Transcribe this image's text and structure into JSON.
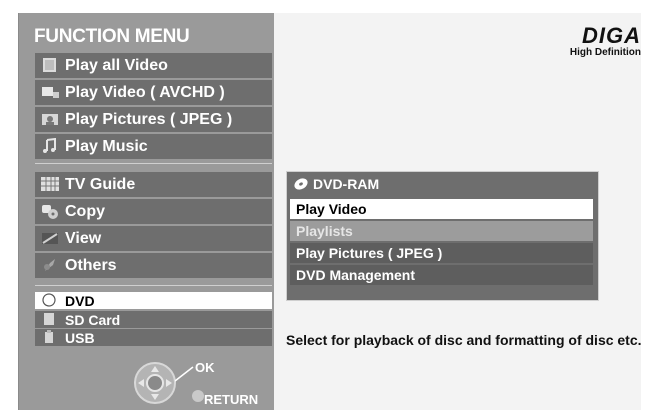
{
  "logo": {
    "brand": "DIGA",
    "subtitle": "High Definition"
  },
  "menu": {
    "title": "FUNCTION MENU",
    "items": [
      {
        "label": "Play all Video",
        "icon": "video-stack-icon"
      },
      {
        "label": "Play Video ( AVCHD )",
        "icon": "camcorder-icon"
      },
      {
        "label": "Play Pictures ( JPEG )",
        "icon": "picture-icon"
      },
      {
        "label": "Play Music",
        "icon": "music-note-icon"
      },
      {
        "label": "TV Guide",
        "icon": "tv-guide-grid-icon"
      },
      {
        "label": "Copy",
        "icon": "copy-disc-icon"
      },
      {
        "label": "View",
        "icon": "view-icon"
      },
      {
        "label": "Others",
        "icon": "others-icon"
      }
    ],
    "sources": [
      {
        "label": "DVD",
        "icon": "disc-icon",
        "selected": true
      },
      {
        "label": "SD Card",
        "icon": "sd-card-icon"
      },
      {
        "label": "USB",
        "icon": "usb-icon"
      }
    ],
    "ok_label": "OK",
    "return_label": "RETURN"
  },
  "submenu": {
    "title": "DVD-RAM",
    "items": [
      {
        "label": "Play Video",
        "state": "selected"
      },
      {
        "label": "Playlists",
        "state": "disabled"
      },
      {
        "label": "Play Pictures ( JPEG )",
        "state": "normal"
      },
      {
        "label": "DVD Management",
        "state": "normal"
      }
    ]
  },
  "description": "Select for playback of disc and formatting of disc etc.",
  "colors": {
    "panel": "#9a9a9a",
    "item": "#6e6e6e",
    "selected": "#ffffff",
    "background": "#f3f3f3"
  }
}
